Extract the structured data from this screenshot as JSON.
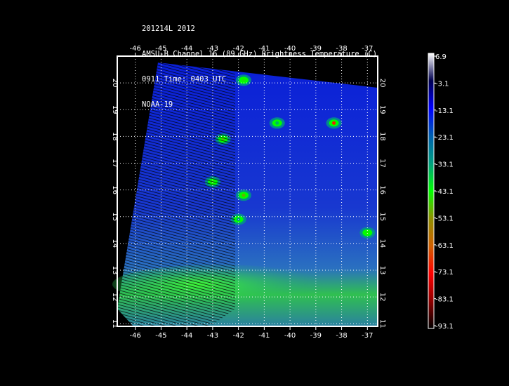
{
  "title_lines": [
    "201214L 2012",
    "AMSU-B Channel 16 (89 GHz) Brightness Temperature (C)",
    "0911 Time: 0403 UTC",
    "NOAA-19"
  ],
  "map": {
    "lon_ticks": [
      -46,
      -45,
      -44,
      -43,
      -42,
      -41,
      -40,
      -39,
      -38,
      -37
    ],
    "lat_ticks": [
      11,
      12,
      13,
      14,
      15,
      16,
      17,
      18,
      19,
      20
    ],
    "lon_range": [
      -46.7,
      -36.6
    ],
    "lat_range": [
      10.9,
      21.0
    ],
    "features": [
      {
        "lon": -41.8,
        "lat": 20.1,
        "value": -45
      },
      {
        "lon": -38.3,
        "lat": 18.5,
        "value": -70
      },
      {
        "lon": -40.5,
        "lat": 18.5,
        "value": -35
      },
      {
        "lon": -42.6,
        "lat": 17.9,
        "value": -48
      },
      {
        "lon": -43.0,
        "lat": 16.3,
        "value": -45
      },
      {
        "lon": -41.8,
        "lat": 15.8,
        "value": -50
      },
      {
        "lon": -42.0,
        "lat": 14.9,
        "value": -32
      },
      {
        "lon": -37.0,
        "lat": 14.4,
        "value": -45
      }
    ]
  },
  "colorbar": {
    "labels": [
      "6.9",
      "-3.1",
      "-13.1",
      "-23.1",
      "-33.1",
      "-43.1",
      "-53.1",
      "-63.1",
      "-73.1",
      "-83.1",
      "-93.1"
    ],
    "colors": [
      "#ffffff",
      "#000050",
      "#0000ff",
      "#0060b0",
      "#00a080",
      "#00ff00",
      "#909000",
      "#d06000",
      "#ff0000",
      "#900000",
      "#000000"
    ]
  }
}
